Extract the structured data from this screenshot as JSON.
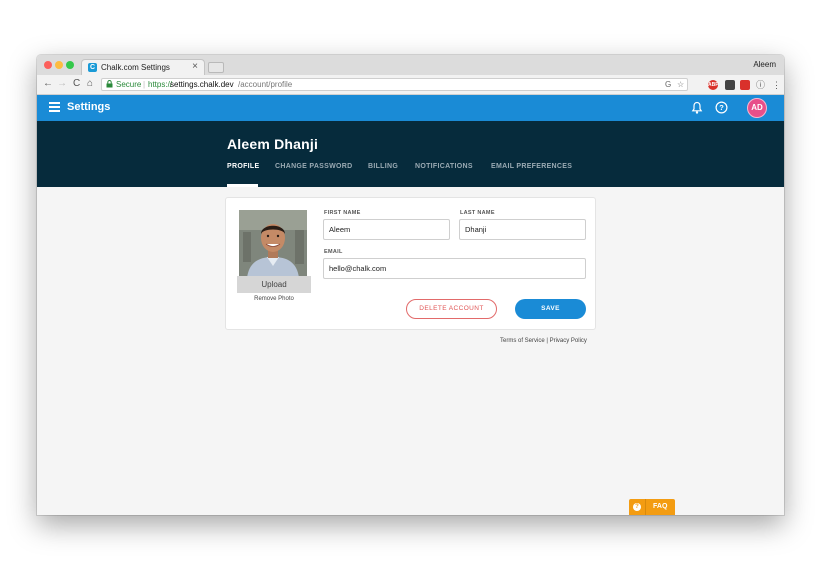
{
  "browser": {
    "tab_title": "Chalk.com Settings",
    "tab_close": "×",
    "profile_name": "Aleem",
    "nav": {
      "back": "←",
      "forward": "→",
      "reload": "C",
      "home": "⌂"
    },
    "address": {
      "secure_label": "Secure",
      "separator": "|",
      "scheme": "https://",
      "host": "settings.chalk.dev",
      "path": "/account/profile"
    },
    "extensions": [
      {
        "name": "shield-ext",
        "label": "G",
        "color": "#555555"
      },
      {
        "name": "star-ext",
        "label": "☆",
        "color": "#555555"
      },
      {
        "name": "adblock-ext",
        "label": "ABP",
        "color": "#d9312b"
      },
      {
        "name": "pocket-ext",
        "label": "",
        "color": "#444444"
      },
      {
        "name": "gmail-ext",
        "label": "",
        "color": "#d9312b"
      },
      {
        "name": "info-ext",
        "label": "i",
        "color": "#555555"
      },
      {
        "name": "menu-ext",
        "label": "⋮",
        "color": "#555555"
      }
    ]
  },
  "app": {
    "title": "Settings",
    "avatar_initials": "AD",
    "accent": "#1a8bd6",
    "banner_color": "#062b3c"
  },
  "profile": {
    "name": "Aleem Dhanji",
    "tabs": [
      "PROFILE",
      "CHANGE PASSWORD",
      "BILLING",
      "NOTIFICATIONS",
      "EMAIL PREFERENCES"
    ],
    "active_tab": "PROFILE"
  },
  "form": {
    "upload_label": "Upload",
    "remove_photo_label": "Remove Photo",
    "first_name_label": "FIRST NAME",
    "first_name_value": "Aleem",
    "last_name_label": "LAST NAME",
    "last_name_value": "Dhanji",
    "email_label": "EMAIL",
    "email_value": "hello@chalk.com",
    "delete_label": "DELETE ACCOUNT",
    "save_label": "SAVE"
  },
  "footer": {
    "terms": "Terms of Service",
    "divider": "|",
    "privacy": "Privacy Policy"
  },
  "faq": {
    "icon": "?",
    "label": "FAQ",
    "color": "#f39c12"
  }
}
